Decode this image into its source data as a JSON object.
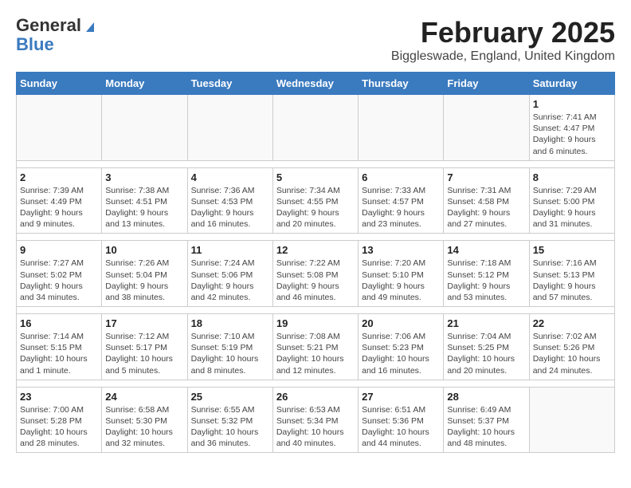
{
  "logo": {
    "line1": "General",
    "line2": "Blue"
  },
  "title": "February 2025",
  "subtitle": "Biggleswade, England, United Kingdom",
  "days_of_week": [
    "Sunday",
    "Monday",
    "Tuesday",
    "Wednesday",
    "Thursday",
    "Friday",
    "Saturday"
  ],
  "weeks": [
    [
      {
        "day": "",
        "info": ""
      },
      {
        "day": "",
        "info": ""
      },
      {
        "day": "",
        "info": ""
      },
      {
        "day": "",
        "info": ""
      },
      {
        "day": "",
        "info": ""
      },
      {
        "day": "",
        "info": ""
      },
      {
        "day": "1",
        "info": "Sunrise: 7:41 AM\nSunset: 4:47 PM\nDaylight: 9 hours and 6 minutes."
      }
    ],
    [
      {
        "day": "2",
        "info": "Sunrise: 7:39 AM\nSunset: 4:49 PM\nDaylight: 9 hours and 9 minutes."
      },
      {
        "day": "3",
        "info": "Sunrise: 7:38 AM\nSunset: 4:51 PM\nDaylight: 9 hours and 13 minutes."
      },
      {
        "day": "4",
        "info": "Sunrise: 7:36 AM\nSunset: 4:53 PM\nDaylight: 9 hours and 16 minutes."
      },
      {
        "day": "5",
        "info": "Sunrise: 7:34 AM\nSunset: 4:55 PM\nDaylight: 9 hours and 20 minutes."
      },
      {
        "day": "6",
        "info": "Sunrise: 7:33 AM\nSunset: 4:57 PM\nDaylight: 9 hours and 23 minutes."
      },
      {
        "day": "7",
        "info": "Sunrise: 7:31 AM\nSunset: 4:58 PM\nDaylight: 9 hours and 27 minutes."
      },
      {
        "day": "8",
        "info": "Sunrise: 7:29 AM\nSunset: 5:00 PM\nDaylight: 9 hours and 31 minutes."
      }
    ],
    [
      {
        "day": "9",
        "info": "Sunrise: 7:27 AM\nSunset: 5:02 PM\nDaylight: 9 hours and 34 minutes."
      },
      {
        "day": "10",
        "info": "Sunrise: 7:26 AM\nSunset: 5:04 PM\nDaylight: 9 hours and 38 minutes."
      },
      {
        "day": "11",
        "info": "Sunrise: 7:24 AM\nSunset: 5:06 PM\nDaylight: 9 hours and 42 minutes."
      },
      {
        "day": "12",
        "info": "Sunrise: 7:22 AM\nSunset: 5:08 PM\nDaylight: 9 hours and 46 minutes."
      },
      {
        "day": "13",
        "info": "Sunrise: 7:20 AM\nSunset: 5:10 PM\nDaylight: 9 hours and 49 minutes."
      },
      {
        "day": "14",
        "info": "Sunrise: 7:18 AM\nSunset: 5:12 PM\nDaylight: 9 hours and 53 minutes."
      },
      {
        "day": "15",
        "info": "Sunrise: 7:16 AM\nSunset: 5:13 PM\nDaylight: 9 hours and 57 minutes."
      }
    ],
    [
      {
        "day": "16",
        "info": "Sunrise: 7:14 AM\nSunset: 5:15 PM\nDaylight: 10 hours and 1 minute."
      },
      {
        "day": "17",
        "info": "Sunrise: 7:12 AM\nSunset: 5:17 PM\nDaylight: 10 hours and 5 minutes."
      },
      {
        "day": "18",
        "info": "Sunrise: 7:10 AM\nSunset: 5:19 PM\nDaylight: 10 hours and 8 minutes."
      },
      {
        "day": "19",
        "info": "Sunrise: 7:08 AM\nSunset: 5:21 PM\nDaylight: 10 hours and 12 minutes."
      },
      {
        "day": "20",
        "info": "Sunrise: 7:06 AM\nSunset: 5:23 PM\nDaylight: 10 hours and 16 minutes."
      },
      {
        "day": "21",
        "info": "Sunrise: 7:04 AM\nSunset: 5:25 PM\nDaylight: 10 hours and 20 minutes."
      },
      {
        "day": "22",
        "info": "Sunrise: 7:02 AM\nSunset: 5:26 PM\nDaylight: 10 hours and 24 minutes."
      }
    ],
    [
      {
        "day": "23",
        "info": "Sunrise: 7:00 AM\nSunset: 5:28 PM\nDaylight: 10 hours and 28 minutes."
      },
      {
        "day": "24",
        "info": "Sunrise: 6:58 AM\nSunset: 5:30 PM\nDaylight: 10 hours and 32 minutes."
      },
      {
        "day": "25",
        "info": "Sunrise: 6:55 AM\nSunset: 5:32 PM\nDaylight: 10 hours and 36 minutes."
      },
      {
        "day": "26",
        "info": "Sunrise: 6:53 AM\nSunset: 5:34 PM\nDaylight: 10 hours and 40 minutes."
      },
      {
        "day": "27",
        "info": "Sunrise: 6:51 AM\nSunset: 5:36 PM\nDaylight: 10 hours and 44 minutes."
      },
      {
        "day": "28",
        "info": "Sunrise: 6:49 AM\nSunset: 5:37 PM\nDaylight: 10 hours and 48 minutes."
      },
      {
        "day": "",
        "info": ""
      }
    ]
  ]
}
